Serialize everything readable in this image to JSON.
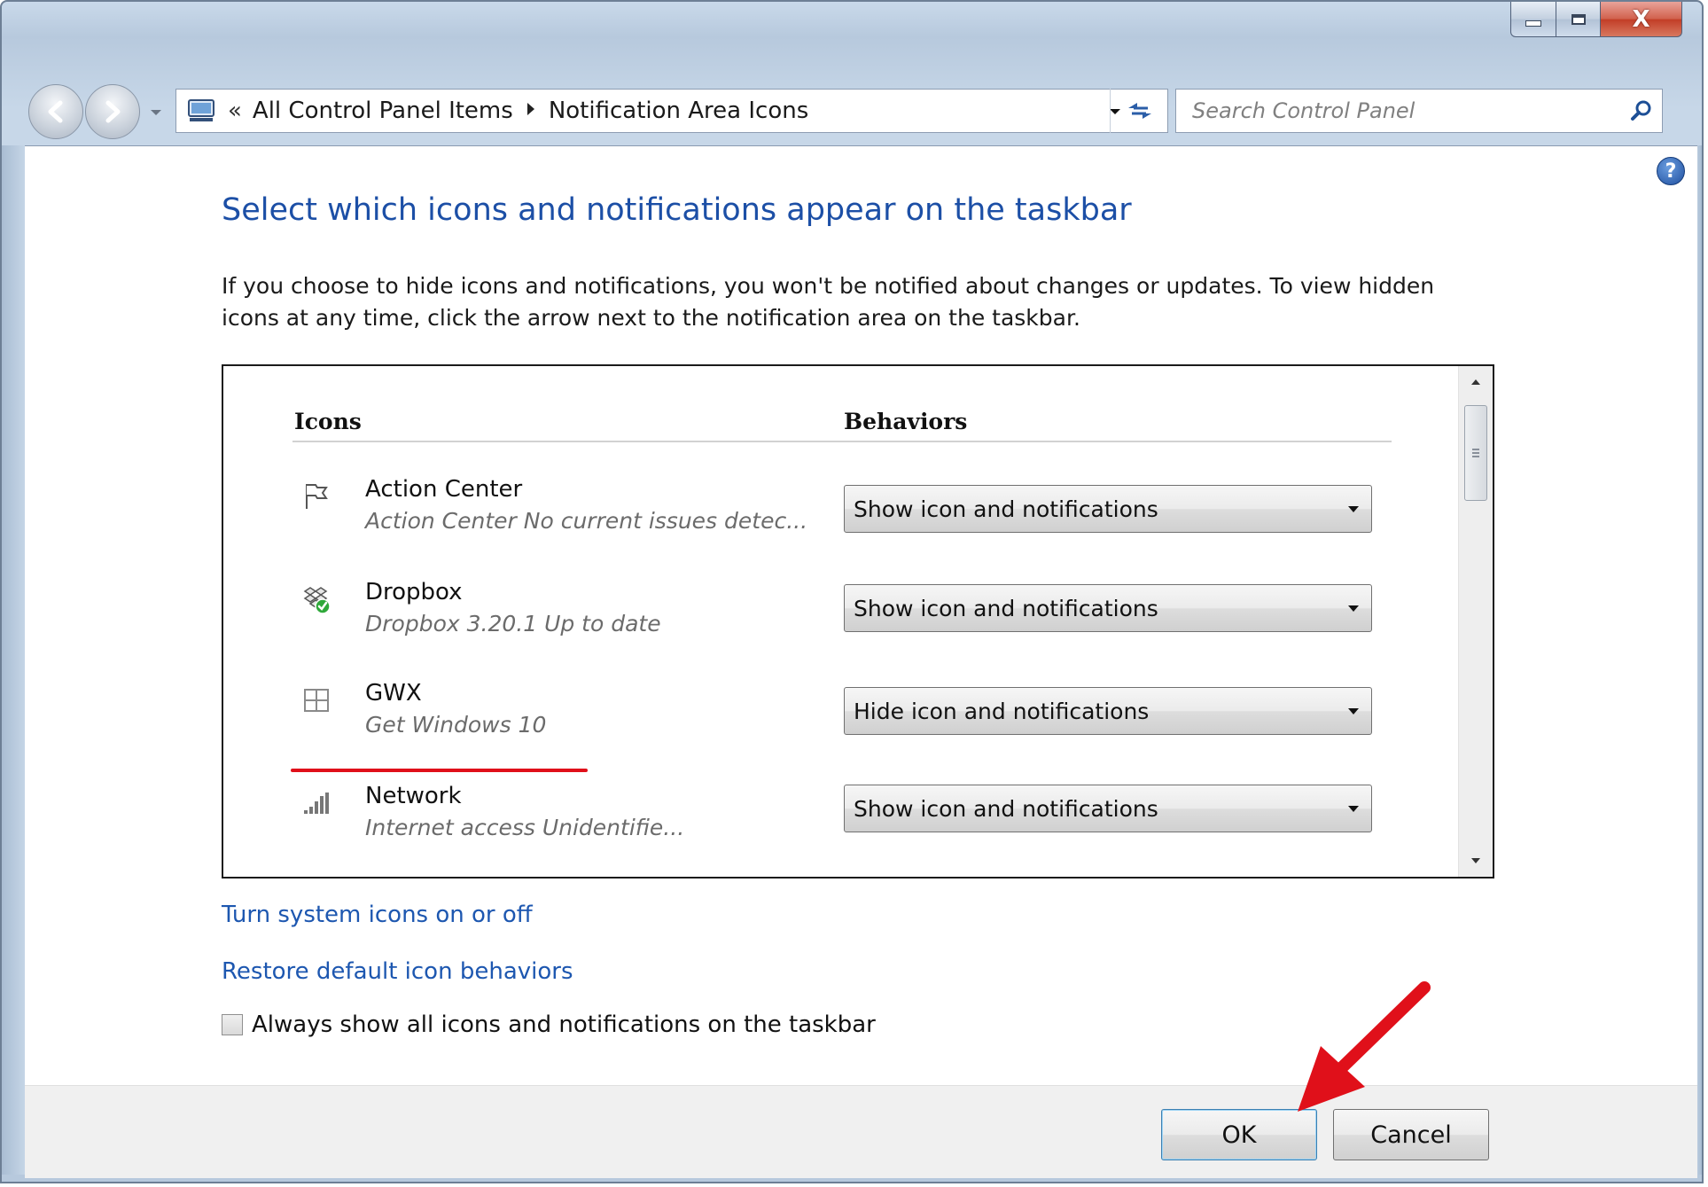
{
  "window": {
    "caption_close": "X"
  },
  "navigation": {
    "breadcrumb_chevron": "«",
    "breadcrumbs": [
      "All Control Panel Items",
      "Notification Area Icons"
    ],
    "search_placeholder": "Search Control Panel"
  },
  "page": {
    "title": "Select which icons and notifications appear on the taskbar",
    "description": "If you choose to hide icons and notifications, you won't be notified about changes or updates. To view hidden icons at any time, click the arrow next to the notification area on the taskbar."
  },
  "table": {
    "headers": {
      "icons": "Icons",
      "behaviors": "Behaviors"
    },
    "rows": [
      {
        "icon": "flag-icon",
        "name": "Action Center",
        "description": "Action Center  No current issues detec...",
        "behavior": "Show icon and notifications"
      },
      {
        "icon": "dropbox-icon",
        "name": "Dropbox",
        "description": "Dropbox 3.20.1 Up to date",
        "behavior": "Show icon and notifications"
      },
      {
        "icon": "windows-icon",
        "name": "GWX",
        "description": "Get Windows 10",
        "behavior": "Hide icon and notifications"
      },
      {
        "icon": "network-icon",
        "name": "Network",
        "description": "Internet access Unidentifie...",
        "behavior": "Show icon and notifications"
      }
    ]
  },
  "links": {
    "system_icons": "Turn system icons on or off",
    "restore_defaults": "Restore default icon behaviors"
  },
  "options": {
    "always_show_label": "Always show all icons and notifications on the taskbar",
    "always_show_checked": false
  },
  "buttons": {
    "ok": "OK",
    "cancel": "Cancel"
  },
  "colors": {
    "link": "#1d57b0",
    "title": "#1c4fa6",
    "annotation_red": "#e0101a"
  }
}
